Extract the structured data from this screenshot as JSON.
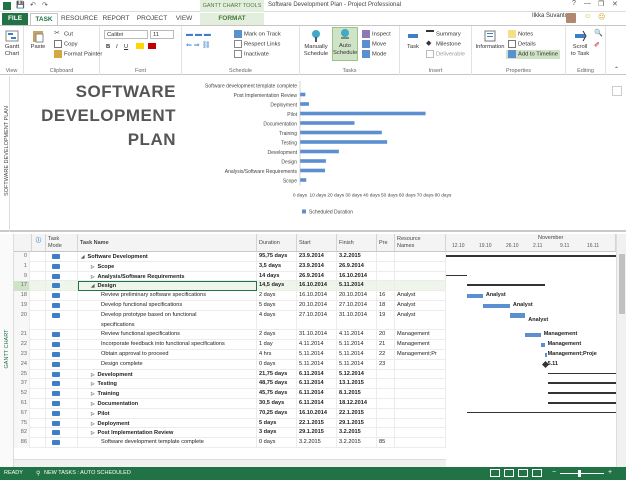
{
  "titlebar": {
    "context_tab_label": "GANTT CHART TOOLS",
    "window_title": "Software Development Plan - Project Professional",
    "user_name": "Ilkka Suvanto",
    "help": "?"
  },
  "tabs": [
    "FILE",
    "TASK",
    "RESOURCE",
    "REPORT",
    "PROJECT",
    "VIEW",
    "FORMAT"
  ],
  "ribbon": {
    "view": {
      "gantt": "Gantt\nChart",
      "label": "View"
    },
    "clipboard": {
      "paste": "Paste",
      "cut": "Cut",
      "copy": "Copy",
      "format_painter": "Format Painter",
      "label": "Clipboard"
    },
    "font": {
      "family": "Calibri",
      "size": "11",
      "bold": "B",
      "italic": "I",
      "underline": "U",
      "label": "Font"
    },
    "schedule": {
      "mark_on_track": "Mark on Track",
      "respect_links": "Respect Links",
      "inactivate": "Inactivate",
      "label": "Schedule"
    },
    "tasks": {
      "manually": "Manually\nSchedule",
      "auto": "Auto\nSchedule",
      "inspect": "Inspect",
      "move": "Move",
      "mode": "Mode",
      "label": "Tasks"
    },
    "insert": {
      "task": "Task",
      "summary": "Summary",
      "milestone": "Milestone",
      "deliverable": "Deliverable",
      "label": "Insert"
    },
    "properties": {
      "information": "Information",
      "notes": "Notes",
      "details": "Details",
      "add_timeline": "Add to Timeline",
      "label": "Properties"
    },
    "editing": {
      "scroll": "Scroll\nto Task",
      "label": "Editing"
    }
  },
  "report": {
    "side_label": "SOFTWARE DEVELOPMENT PLAN",
    "title_lines": [
      "SOFTWARE",
      "DEVELOPMENT",
      "PLAN"
    ],
    "legend": "Scheduled Duration"
  },
  "chart_data": {
    "type": "bar",
    "orientation": "horizontal",
    "categories": [
      "Software development template complete",
      "Post Implementation Review",
      "Deployment",
      "Pilot",
      "Documentation",
      "Training",
      "Testing",
      "Development",
      "Design",
      "Analysis/Software Requirements",
      "Scope"
    ],
    "series": [
      {
        "name": "Scheduled Duration",
        "values": [
          0,
          3,
          5,
          70.25,
          30.5,
          45.75,
          48.75,
          21.75,
          14.5,
          14,
          3.5
        ]
      }
    ],
    "xticks": [
      "0 days",
      "10 days",
      "20 days",
      "30 days",
      "40 days",
      "50 days",
      "60 days",
      "70 days",
      "80 days"
    ],
    "xlim": [
      0,
      80
    ],
    "grid": false,
    "legend_position": "bottom"
  },
  "grid": {
    "side_label": "GANTT CHART",
    "headers": {
      "mode": "Task\nMode",
      "name": "Task Name",
      "duration": "Duration",
      "start": "Start",
      "finish": "Finish",
      "pred": "Pre",
      "resource": "Resource\nNames"
    },
    "timescale": {
      "month": "November",
      "dates": [
        "12.10",
        "19.10",
        "26.10",
        "2.11",
        "9.11",
        "16.11"
      ]
    },
    "rows": [
      {
        "id": "0",
        "name": "Software Development",
        "dur": "95,75 days",
        "start": "23.9.2014",
        "finish": "3.2.2015",
        "pred": "",
        "res": "",
        "bold": true,
        "indent": 0,
        "toggle": "◢"
      },
      {
        "id": "1",
        "name": "Scope",
        "dur": "3,5 days",
        "start": "23.9.2014",
        "finish": "26.9.2014",
        "pred": "",
        "res": "",
        "bold": true,
        "indent": 1,
        "toggle": "▷"
      },
      {
        "id": "9",
        "name": "Analysis/Software Requirements",
        "dur": "14 days",
        "start": "26.9.2014",
        "finish": "16.10.2014",
        "pred": "",
        "res": "",
        "bold": true,
        "indent": 1,
        "toggle": "▷"
      },
      {
        "id": "17",
        "name": "Design",
        "dur": "14,5 days",
        "start": "16.10.2014",
        "finish": "5.11.2014",
        "pred": "",
        "res": "",
        "bold": true,
        "indent": 1,
        "toggle": "◢",
        "selected": true
      },
      {
        "id": "18",
        "name": "Review preliminary software specifications",
        "dur": "2 days",
        "start": "16.10.2014",
        "finish": "20.10.2014",
        "pred": "16",
        "res": "Analyst",
        "bold": false,
        "indent": 2,
        "toggle": ""
      },
      {
        "id": "19",
        "name": "Develop functional specifications",
        "dur": "5 days",
        "start": "20.10.2014",
        "finish": "27.10.2014",
        "pred": "18",
        "res": "Analyst",
        "bold": false,
        "indent": 2,
        "toggle": ""
      },
      {
        "id": "20",
        "name": "Develop prototype based on functional",
        "name2": "specifications",
        "dur": "4 days",
        "start": "27.10.2014",
        "finish": "31.10.2014",
        "pred": "19",
        "res": "Analyst",
        "bold": false,
        "indent": 2,
        "toggle": "",
        "tall": true
      },
      {
        "id": "21",
        "name": "Review functional specifications",
        "dur": "2 days",
        "start": "31.10.2014",
        "finish": "4.11.2014",
        "pred": "20",
        "res": "Management",
        "bold": false,
        "indent": 2,
        "toggle": ""
      },
      {
        "id": "22",
        "name": "Incorporate feedback into functional specifications",
        "dur": "1 day",
        "start": "4.11.2014",
        "finish": "5.11.2014",
        "pred": "21",
        "res": "Management",
        "bold": false,
        "indent": 2,
        "toggle": ""
      },
      {
        "id": "23",
        "name": "Obtain approval to proceed",
        "dur": "4 hrs",
        "start": "5.11.2014",
        "finish": "5.11.2014",
        "pred": "22",
        "res": "Management;Pr",
        "bold": false,
        "indent": 2,
        "toggle": ""
      },
      {
        "id": "24",
        "name": "Design complete",
        "dur": "0 days",
        "start": "5.11.2014",
        "finish": "5.11.2014",
        "pred": "23",
        "res": "",
        "bold": false,
        "indent": 2,
        "toggle": ""
      },
      {
        "id": "25",
        "name": "Development",
        "dur": "21,75 days",
        "start": "6.11.2014",
        "finish": "5.12.2014",
        "pred": "",
        "res": "",
        "bold": true,
        "indent": 1,
        "toggle": "▷"
      },
      {
        "id": "37",
        "name": "Testing",
        "dur": "48,75 days",
        "start": "6.11.2014",
        "finish": "13.1.2015",
        "pred": "",
        "res": "",
        "bold": true,
        "indent": 1,
        "toggle": "▷"
      },
      {
        "id": "52",
        "name": "Training",
        "dur": "45,75 days",
        "start": "6.11.2014",
        "finish": "8.1.2015",
        "pred": "",
        "res": "",
        "bold": true,
        "indent": 1,
        "toggle": "▷"
      },
      {
        "id": "61",
        "name": "Documentation",
        "dur": "30,5 days",
        "start": "6.11.2014",
        "finish": "18.12.2014",
        "pred": "",
        "res": "",
        "bold": true,
        "indent": 1,
        "toggle": "▷"
      },
      {
        "id": "67",
        "name": "Pilot",
        "dur": "70,25 days",
        "start": "16.10.2014",
        "finish": "22.1.2015",
        "pred": "",
        "res": "",
        "bold": true,
        "indent": 1,
        "toggle": "▷"
      },
      {
        "id": "75",
        "name": "Deployment",
        "dur": "5 days",
        "start": "22.1.2015",
        "finish": "29.1.2015",
        "pred": "",
        "res": "",
        "bold": true,
        "indent": 1,
        "toggle": "▷"
      },
      {
        "id": "82",
        "name": "Post Implementation Review",
        "dur": "3 days",
        "start": "29.1.2015",
        "finish": "3.2.2015",
        "pred": "",
        "res": "",
        "bold": true,
        "indent": 1,
        "toggle": "▷"
      },
      {
        "id": "86",
        "name": "Software development template complete",
        "dur": "0 days",
        "start": "3.2.2015",
        "finish": "3.2.2015",
        "pred": "85",
        "res": "",
        "bold": false,
        "indent": 2,
        "toggle": ""
      }
    ],
    "gantt_labels": [
      "Analyst",
      "Analyst",
      "Analyst",
      "Management",
      "Management",
      "Management;Proje",
      "5.11"
    ]
  },
  "status": {
    "ready": "READY",
    "new_tasks": "NEW TASKS : AUTO SCHEDULED"
  },
  "colors": {
    "accent": "#217346",
    "bar": "#5b8fd0",
    "selected": "#217346"
  }
}
